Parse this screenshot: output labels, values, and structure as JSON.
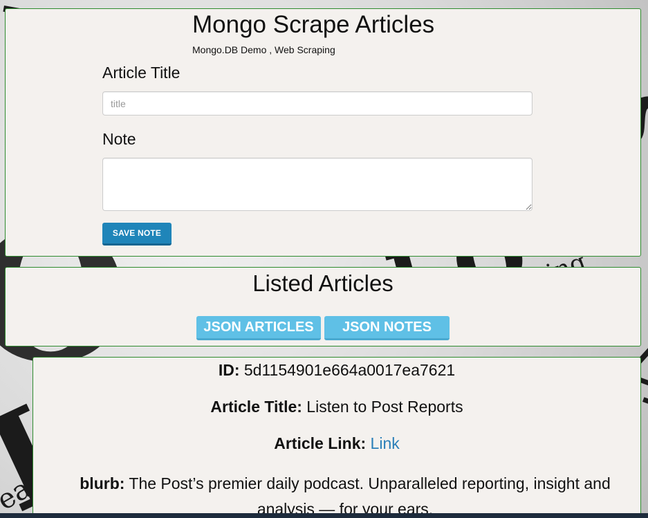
{
  "app": {
    "title": "Mongo Scrape Articles",
    "subtitle": "Mongo.DB Demo , Web Scraping"
  },
  "form": {
    "article_title_label": "Article Title",
    "title_placeholder": "title",
    "title_value": "",
    "note_label": "Note",
    "note_value": "",
    "save_label": "SAVE NOTE"
  },
  "listed": {
    "heading": "Listed Articles",
    "json_articles_label": "JSON ARTICLES",
    "json_notes_label": "JSON NOTES"
  },
  "article": {
    "id_label": "ID:",
    "id_value": "5d1154901e664a0017ea7621",
    "title_label": "Article Title:",
    "title_value": "Listen to Post Reports",
    "link_label": "Article Link:",
    "link_text": "Link",
    "blurb_label": "blurb:",
    "blurb_value": "The Post’s premier daily podcast. Unparalleled reporting, insight and analysis — for your ears."
  },
  "colors": {
    "panel_bg": "#f4f1ee",
    "panel_border": "#2e8b2e",
    "save_button": "#1f85b9",
    "json_button": "#5fc0e6",
    "link": "#2a7fb8"
  }
}
